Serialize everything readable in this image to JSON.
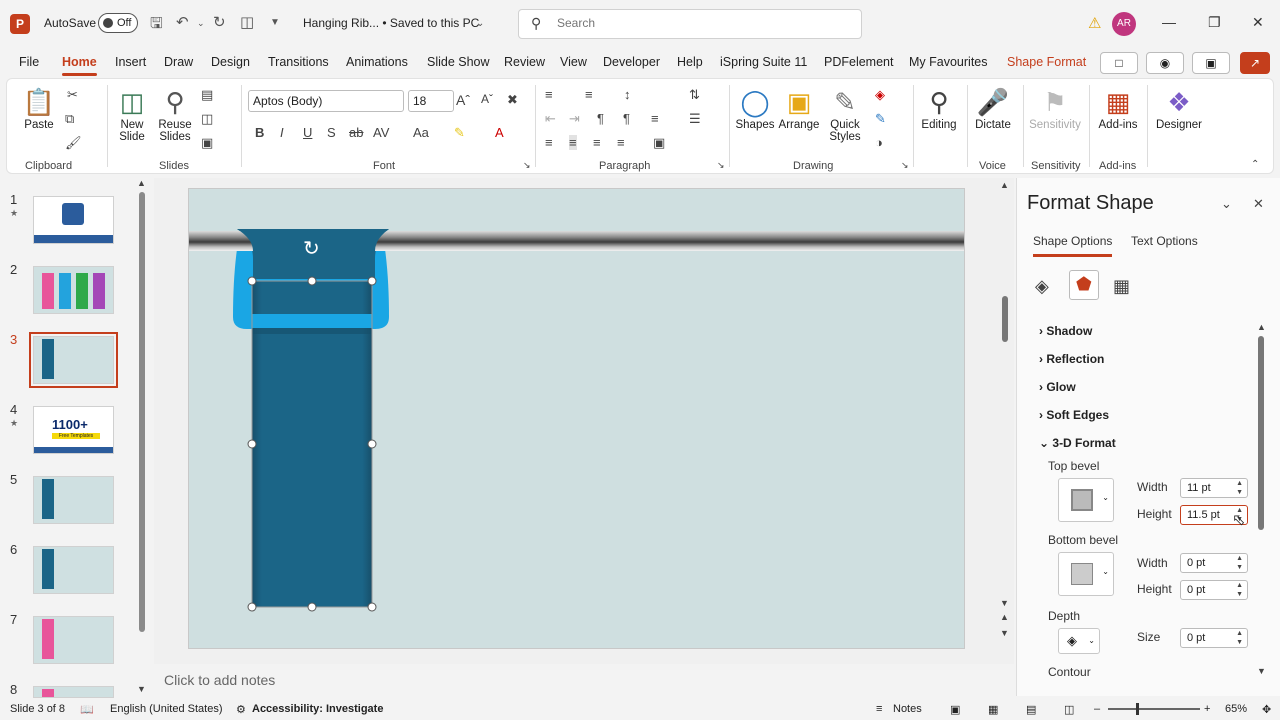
{
  "titlebar": {
    "autosave_label": "AutoSave",
    "autosave_state": "Off",
    "doc_title": "Hanging Rib...  •  Saved to this PC",
    "search_placeholder": "Search",
    "avatar_initials": "AR"
  },
  "menu": {
    "tabs": [
      "File",
      "Home",
      "Insert",
      "Draw",
      "Design",
      "Transitions",
      "Animations",
      "Slide Show",
      "Review",
      "View",
      "Developer",
      "Help",
      "iSpring Suite 11",
      "PDFelement",
      "My Favourites",
      "Shape Format"
    ],
    "active_tab": "Home"
  },
  "ribbon": {
    "clipboard": {
      "label": "Clipboard",
      "paste": "Paste"
    },
    "slides": {
      "label": "Slides",
      "new_slide": "New",
      "new_slide2": "Slide",
      "reuse": "Reuse",
      "reuse2": "Slides"
    },
    "font": {
      "label": "Font",
      "family": "Aptos (Body)",
      "size": "18"
    },
    "paragraph": {
      "label": "Paragraph"
    },
    "drawing": {
      "label": "Drawing",
      "shapes": "Shapes",
      "arrange": "Arrange",
      "quick_styles": "Quick",
      "quick_styles2": "Styles"
    },
    "editing": {
      "label": "Editing"
    },
    "voice": {
      "label": "Voice",
      "dictate": "Dictate"
    },
    "sensitivity": {
      "label": "Sensitivity",
      "btn": "Sensitivity"
    },
    "addins": {
      "label": "Add-ins",
      "btn": "Add-ins"
    },
    "designer": {
      "btn": "Designer"
    }
  },
  "thumbnails": [
    {
      "num": "1",
      "star": true
    },
    {
      "num": "2",
      "star": false
    },
    {
      "num": "3",
      "star": false,
      "selected": true
    },
    {
      "num": "4",
      "star": true,
      "text": "1100+",
      "subtext": "Free Templates"
    },
    {
      "num": "5",
      "star": false
    },
    {
      "num": "6",
      "star": false
    },
    {
      "num": "7",
      "star": false
    },
    {
      "num": "8",
      "star": false
    }
  ],
  "notes_placeholder": "Click to add notes",
  "format_pane": {
    "title": "Format Shape",
    "tab_shape": "Shape Options",
    "tab_text": "Text Options",
    "sections": [
      "Shadow",
      "Reflection",
      "Glow",
      "Soft Edges",
      "3-D Format"
    ],
    "top_bevel": "Top bevel",
    "bottom_bevel": "Bottom bevel",
    "depth": "Depth",
    "contour": "Contour",
    "width_label": "Width",
    "height_label": "Height",
    "size_label": "Size",
    "top_width": "11 pt",
    "top_height": "11.5 pt",
    "bottom_width": "0 pt",
    "bottom_height": "0 pt",
    "depth_size": "0 pt"
  },
  "status": {
    "slide_info": "Slide 3 of 8",
    "language": "English (United States)",
    "accessibility": "Accessibility: Investigate",
    "notes": "Notes",
    "zoom": "65%"
  },
  "colors": {
    "accent": "#c43e1c",
    "ribbon_dark": "#1b6587",
    "ribbon_light": "#1aa6e4",
    "slide_bg": "#cfdfe0"
  }
}
